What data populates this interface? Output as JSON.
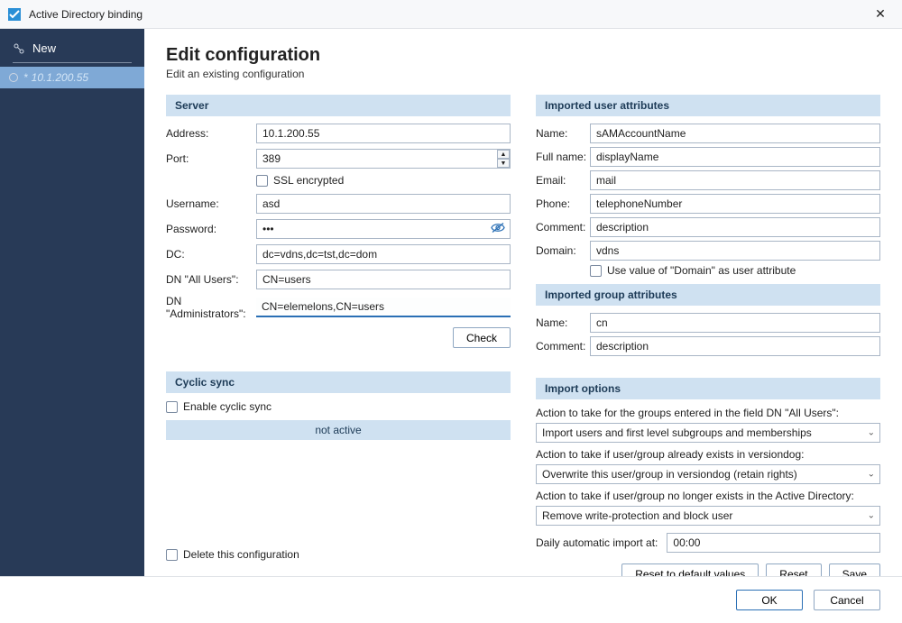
{
  "window": {
    "title": "Active Directory binding",
    "close_glyph": "✕"
  },
  "sidebar": {
    "new_label": "New",
    "items": [
      {
        "label": "10.1.200.55",
        "dirty": "*"
      }
    ]
  },
  "page": {
    "heading": "Edit configuration",
    "subtitle": "Edit an existing configuration"
  },
  "server": {
    "header": "Server",
    "address_label": "Address:",
    "address_value": "10.1.200.55",
    "port_label": "Port:",
    "port_value": "389",
    "ssl_label": "SSL encrypted",
    "username_label": "Username:",
    "username_value": "asd",
    "password_label": "Password:",
    "password_value": "•••",
    "dc_label": "DC:",
    "dc_value": "dc=vdns,dc=tst,dc=dom",
    "dn_users_label": "DN \"All Users\":",
    "dn_users_value": "CN=users",
    "dn_admins_label": "DN \"Administrators\":",
    "dn_admins_value": "CN=elemelons,CN=users",
    "check_button": "Check"
  },
  "cyclic": {
    "header": "Cyclic sync",
    "enable_label": "Enable cyclic sync",
    "status": "not active",
    "delete_label": "Delete this configuration"
  },
  "user_attrs": {
    "header": "Imported user attributes",
    "name_label": "Name:",
    "name_value": "sAMAccountName",
    "fullname_label": "Full name:",
    "fullname_value": "displayName",
    "email_label": "Email:",
    "email_value": "mail",
    "phone_label": "Phone:",
    "phone_value": "telephoneNumber",
    "comment_label": "Comment:",
    "comment_value": "description",
    "domain_label": "Domain:",
    "domain_value": "vdns",
    "domain_as_attr_label": "Use value of \"Domain\" as user attribute"
  },
  "group_attrs": {
    "header": "Imported group attributes",
    "name_label": "Name:",
    "name_value": "cn",
    "comment_label": "Comment:",
    "comment_value": "description"
  },
  "import_opts": {
    "header": "Import options",
    "q1": "Action to take for the groups entered in the field DN \"All Users\":",
    "q1_value": "Import users and first level subgroups and memberships",
    "q2": "Action to take if user/group already exists in versiondog:",
    "q2_value": "Overwrite this user/group in versiondog (retain rights)",
    "q3": "Action to take if user/group no longer exists in the Active Directory:",
    "q3_value": "Remove write-protection and block user",
    "daily_label": "Daily automatic import at:",
    "daily_value": "00:00",
    "reset_defaults": "Reset to default values",
    "reset": "Reset",
    "save": "Save"
  },
  "footer": {
    "ok": "OK",
    "cancel": "Cancel"
  }
}
